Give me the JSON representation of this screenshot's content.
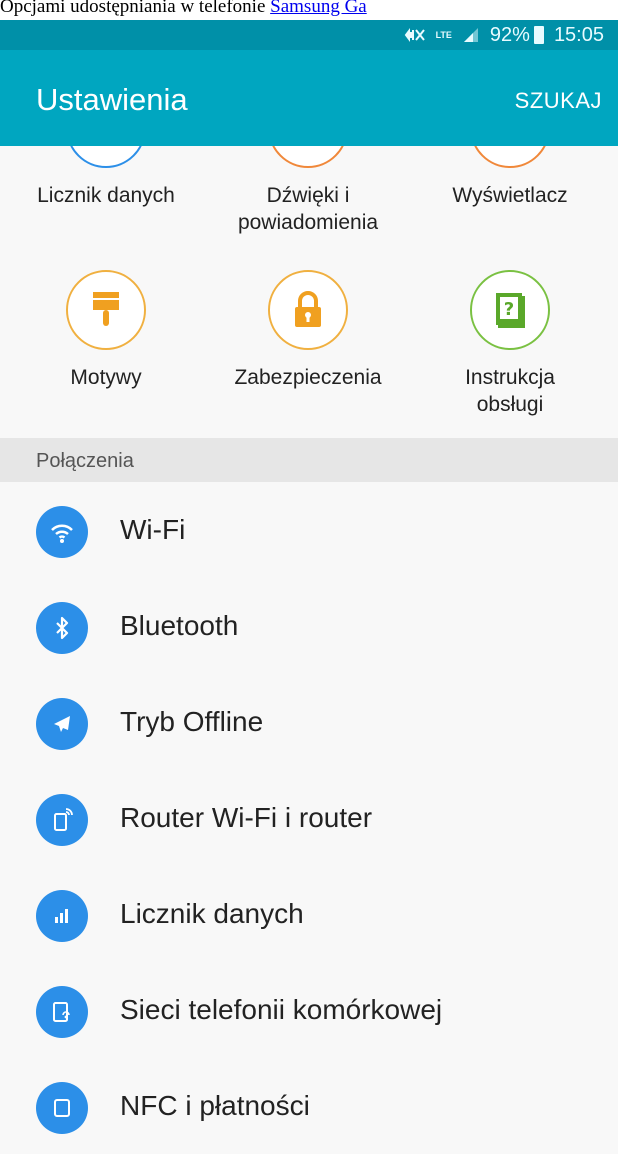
{
  "caption": {
    "text": "Opcjami udostępniania w telefonie ",
    "link": "Samsung Ga"
  },
  "status_bar": {
    "signal_text": "LTE",
    "battery": "92%",
    "time": "15:05"
  },
  "app_bar": {
    "title": "Ustawienia",
    "search_label": "SZUKAJ"
  },
  "quick_settings": [
    {
      "label": "Licznik danych",
      "icon": "data-usage-icon",
      "color": "#2c8fe8"
    },
    {
      "label": "Dźwięki i\npowiadomienia",
      "icon": "sound-icon",
      "color": "#f0883a"
    },
    {
      "label": "Wyświetlacz",
      "icon": "display-icon",
      "color": "#f0883a"
    },
    {
      "label": "Motywy",
      "icon": "paintbrush-icon",
      "color": "#f0b040"
    },
    {
      "label": "Zabezpieczenia",
      "icon": "lock-icon",
      "color": "#f0b040"
    },
    {
      "label": "Instrukcja\nobsługi",
      "icon": "help-book-icon",
      "color": "#7ac142"
    }
  ],
  "section": {
    "title": "Połączenia"
  },
  "connections": [
    {
      "label": "Wi-Fi",
      "icon": "wifi-icon"
    },
    {
      "label": "Bluetooth",
      "icon": "bluetooth-icon"
    },
    {
      "label": "Tryb Offline",
      "icon": "airplane-icon"
    },
    {
      "label": "Router Wi-Fi i router",
      "icon": "hotspot-icon"
    },
    {
      "label": "Licznik danych",
      "icon": "data-usage-icon"
    },
    {
      "label": "Sieci telefonii komórkowej",
      "icon": "mobile-network-icon"
    },
    {
      "label": "NFC i płatności",
      "icon": "nfc-icon"
    }
  ],
  "colors": {
    "status_bar": "#0090a8",
    "app_bar": "#00a6c0",
    "list_icon": "#2c8fe8"
  }
}
